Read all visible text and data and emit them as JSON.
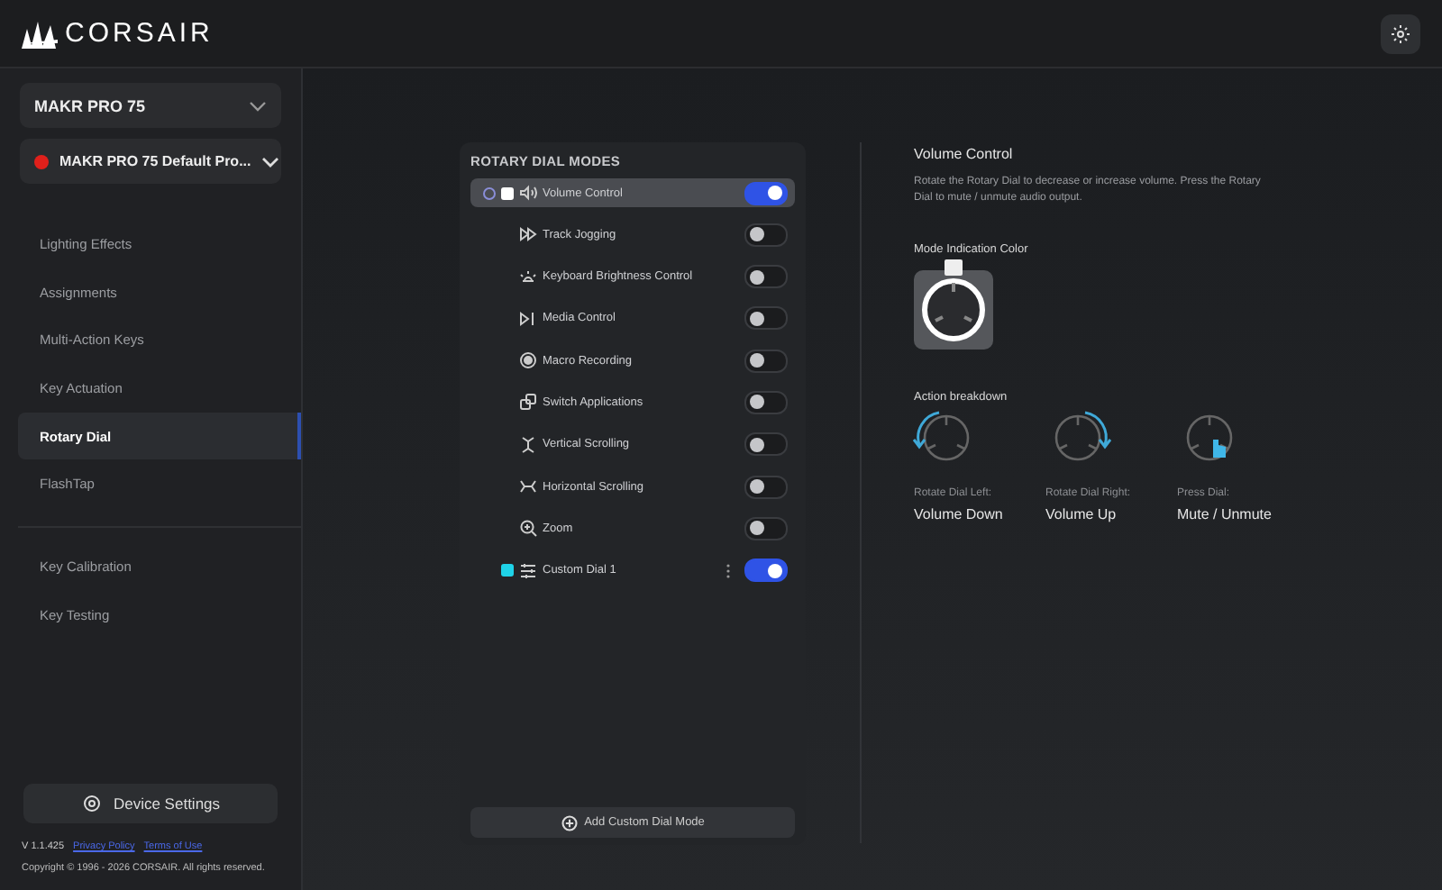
{
  "header": {
    "logo_text": "CORSAIR"
  },
  "sidebar": {
    "device_select": {
      "value": "MAKR PRO 75"
    },
    "profile_select": {
      "value": "MAKR PRO 75 Default Pro...",
      "color": "#e0201b"
    },
    "nav_sections": [
      {
        "items": [
          {
            "label": "Lighting Effects",
            "selected": false
          },
          {
            "label": "Assignments",
            "selected": false
          },
          {
            "label": "Multi-Action Keys",
            "selected": false
          },
          {
            "label": "Key Actuation",
            "selected": false
          },
          {
            "label": "Rotary Dial",
            "selected": true
          },
          {
            "label": "FlashTap",
            "selected": false
          }
        ]
      },
      {
        "items": [
          {
            "label": "Key Calibration",
            "selected": false
          },
          {
            "label": "Key Testing",
            "selected": false
          }
        ]
      }
    ],
    "device_settings_button": "Device Settings",
    "version": "V 1.1.425",
    "links": [
      "Privacy Policy",
      "Terms of Use"
    ],
    "copyright": "Copyright © 1996 - 2026 CORSAIR. All rights reserved."
  },
  "modes_panel": {
    "title": "ROTARY DIAL MODES",
    "modes": [
      {
        "kind": "preset",
        "label": "Volume Control",
        "selected": true,
        "on": true,
        "color": "#ffffff"
      },
      {
        "kind": "preset",
        "label": "Track Jogging",
        "selected": false,
        "on": false
      },
      {
        "kind": "preset",
        "label": "Keyboard Brightness Control",
        "selected": false,
        "on": false
      },
      {
        "kind": "preset",
        "label": "Media Control",
        "selected": false,
        "on": false
      },
      {
        "kind": "preset",
        "label": "Macro Recording",
        "selected": false,
        "on": false
      },
      {
        "kind": "preset",
        "label": "Switch Applications",
        "selected": false,
        "on": false
      },
      {
        "kind": "preset",
        "label": "Vertical Scrolling",
        "selected": false,
        "on": false
      },
      {
        "kind": "preset",
        "label": "Horizontal Scrolling",
        "selected": false,
        "on": false
      },
      {
        "kind": "preset",
        "label": "Zoom",
        "selected": false,
        "on": false
      },
      {
        "kind": "custom",
        "label": "Custom Dial 1",
        "selected": false,
        "on": true,
        "color": "#1fd3e8"
      }
    ],
    "add_button": "Add Custom Dial Mode"
  },
  "detail": {
    "title": "Volume Control",
    "description": "Rotate the Rotary Dial to decrease or increase volume. Press the Rotary Dial to mute / unmute audio output.",
    "color_label": "Mode Indication Color",
    "breakdown_label": "Action breakdown",
    "actions": [
      {
        "kind": "left",
        "label": "Rotate Dial Left:",
        "value": "Volume Down"
      },
      {
        "kind": "right",
        "label": "Rotate Dial Right:",
        "value": "Volume Up"
      },
      {
        "kind": "press",
        "label": "Press Dial:",
        "value": "Mute / Unmute"
      }
    ]
  }
}
